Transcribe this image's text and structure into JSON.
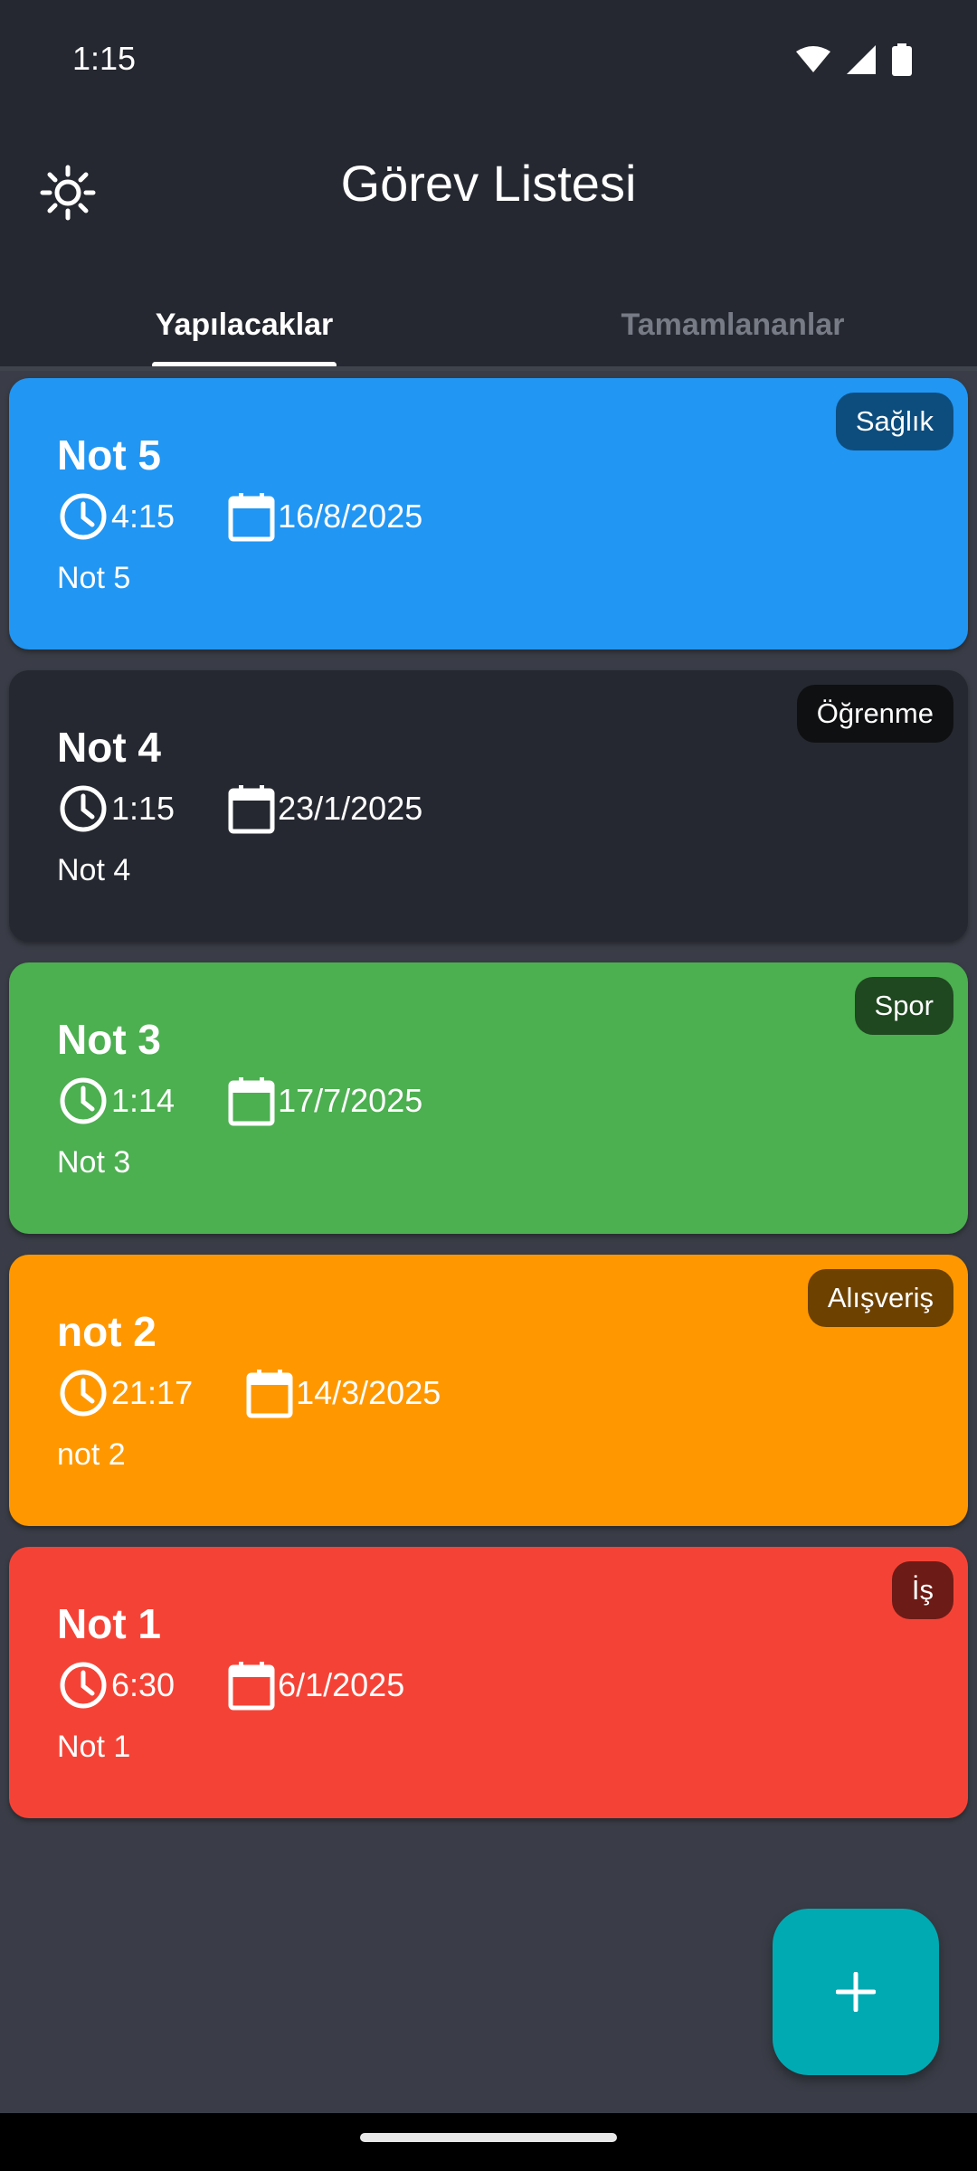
{
  "status_bar": {
    "time": "1:15"
  },
  "app_bar": {
    "title": "Görev Listesi"
  },
  "tabs": [
    {
      "label": "Yapılacaklar",
      "selected": true
    },
    {
      "label": "Tamamlananlar",
      "selected": false
    }
  ],
  "tasks": [
    {
      "title": "Not 5",
      "time": "4:15",
      "date": "16/8/2025",
      "body": "Not 5",
      "category": "Sağlık",
      "color": "#2196f3",
      "chip_color": "#0d4d7e"
    },
    {
      "title": "Not 4",
      "time": "1:15",
      "date": "23/1/2025",
      "body": "Not 4",
      "category": "Öğrenme",
      "color": "#252830",
      "chip_color": "#0f1012"
    },
    {
      "title": "Not 3",
      "time": "1:14",
      "date": "17/7/2025",
      "body": "Not 3",
      "category": "Spor",
      "color": "#4caf50",
      "chip_color": "#1f4720"
    },
    {
      "title": "not 2",
      "time": "21:17",
      "date": "14/3/2025",
      "body": "not 2",
      "category": "Alışveriş",
      "color": "#ff9800",
      "chip_color": "#6d4100"
    },
    {
      "title": "Not 1",
      "time": "6:30",
      "date": "6/1/2025",
      "body": "Not 1",
      "category": "İş",
      "color": "#f44336",
      "chip_color": "#6d1b16"
    }
  ],
  "icons": {
    "theme_toggle": "sun-icon",
    "time": "clock-icon",
    "date": "calendar-icon",
    "fab": "plus-icon"
  },
  "colors": {
    "background": "#3a3d47",
    "app_bar": "#252830",
    "fab": "#00aab3"
  }
}
